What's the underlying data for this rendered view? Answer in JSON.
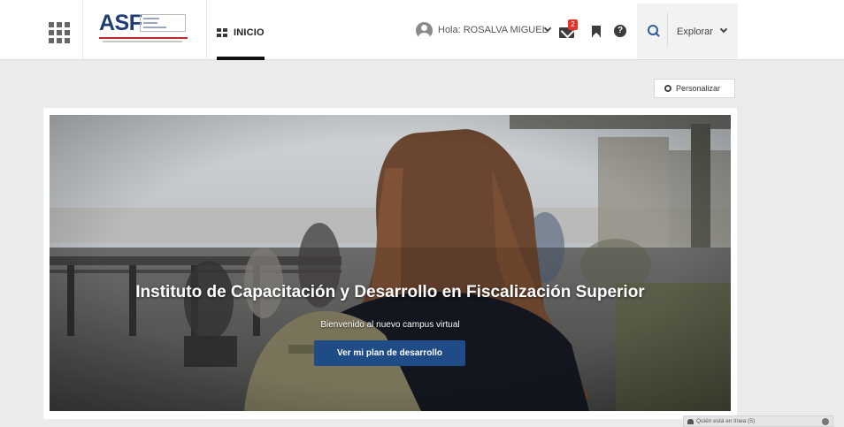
{
  "header": {
    "apps_icon": "grid-apps-icon",
    "logo": {
      "text": "ASF",
      "tagline_lines": [
        "Auditoría",
        "Superior",
        "de la Federación"
      ],
      "caption": "CÁMARA DE DIPUTADOS"
    },
    "nav": {
      "inicio_label": "INICIO"
    },
    "user": {
      "greeting": "Hola: ROSALVA MIGUEL"
    },
    "messages": {
      "unread_count": "2"
    },
    "help_glyph": "?",
    "explore_label": "Explorar"
  },
  "main": {
    "personalize_label": "Personalizar",
    "hero": {
      "title": "Instituto de Capacitación y Desarrollo en Fiscalización Superior",
      "subtitle": "Bienvenido al nuevo campus virtual",
      "button_label": "Ver mi plan de desarrollo"
    }
  },
  "footer": {
    "online_label": "Quién está en línea (5)"
  },
  "colors": {
    "primary": "#1f4b87",
    "badge": "#e5332a",
    "accent_red": "#c0272d"
  }
}
